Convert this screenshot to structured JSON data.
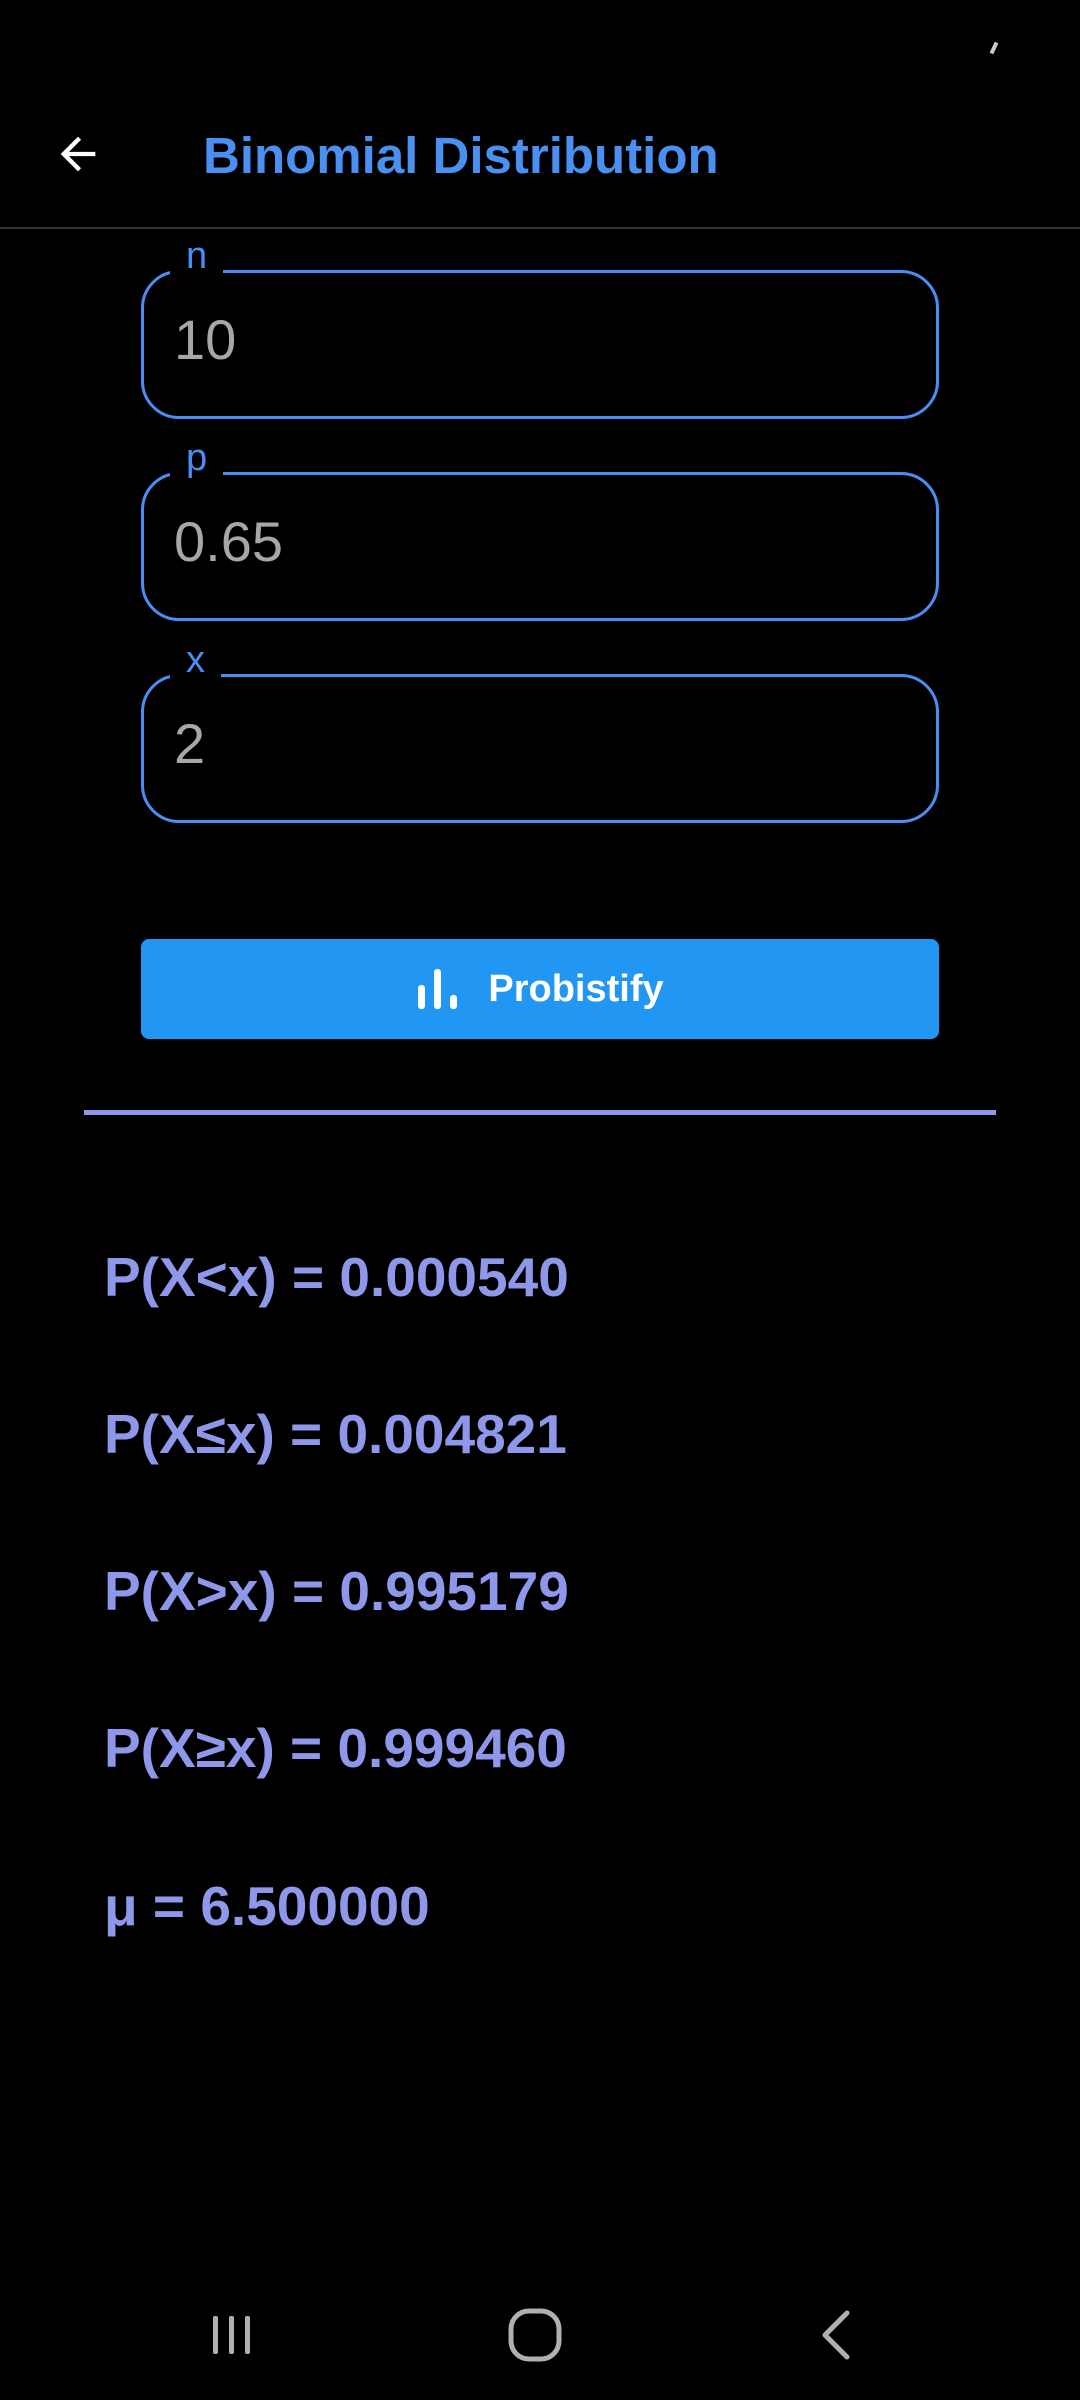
{
  "app_bar": {
    "title": "Binomial Distribution",
    "back_icon": "arrow-left-icon"
  },
  "form": {
    "n": {
      "label": "n",
      "value": "10"
    },
    "p": {
      "label": "p",
      "value": "0.65"
    },
    "x": {
      "label": "x",
      "value": "2"
    }
  },
  "action": {
    "label": "Probistify",
    "icon": "bar-chart-icon"
  },
  "results": {
    "p_less": "P(X<x) = 0.000540",
    "p_less_equal": "P(X≤x) = 0.004821",
    "p_greater": "P(X>x) = 0.995179",
    "p_greater_equal": "P(X≥x) = 0.999460",
    "mean": "μ = 6.500000"
  },
  "nav_bar": {
    "recents_icon": "recent-apps-icon",
    "home_icon": "home-icon",
    "back_icon": "back-chevron-icon"
  },
  "colors": {
    "title": "#4a90f0",
    "field_border": "#4a8ef5",
    "button": "#2196f3",
    "result_text": "#8f97ea",
    "background": "#000000"
  }
}
